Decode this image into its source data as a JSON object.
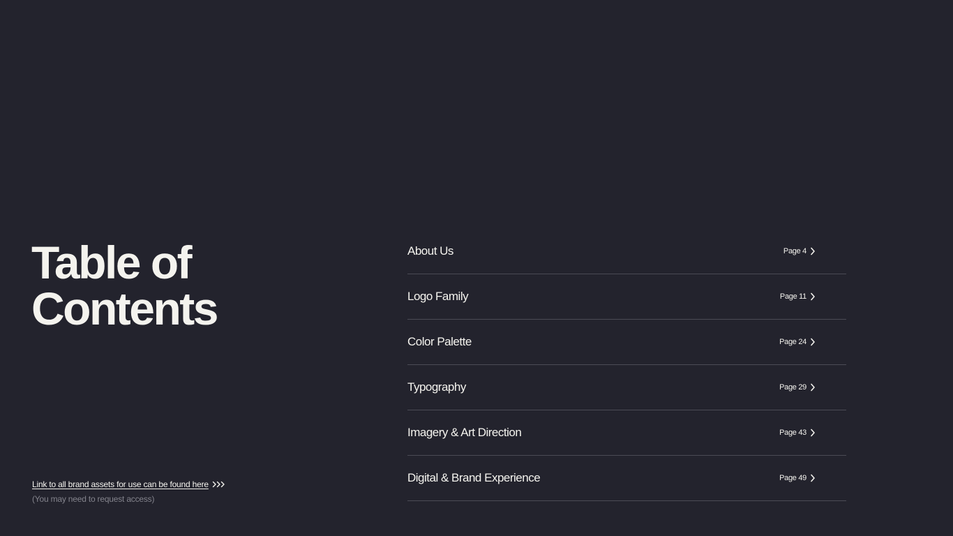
{
  "heading": {
    "line1": "Table of",
    "line2": "Contents"
  },
  "assets": {
    "link_label": "Link to all brand assets for use can be found here",
    "note": "(You may need to request access)"
  },
  "toc": {
    "items": [
      {
        "label": "About Us",
        "page": "Page 4"
      },
      {
        "label": "Logo Family",
        "page": "Page 11"
      },
      {
        "label": "Color Palette",
        "page": "Page 24"
      },
      {
        "label": "Typography",
        "page": "Page 29"
      },
      {
        "label": "Imagery & Art Direction",
        "page": "Page 43"
      },
      {
        "label": "Digital & Brand Experience",
        "page": "Page 49"
      }
    ]
  },
  "icons": {
    "row_arrow": "chevron-right-icon",
    "link_arrow": "triple-chevron-right-icon"
  },
  "colors": {
    "background": "#23232d",
    "text": "#f4f3ee",
    "muted": "#83838c",
    "divider": "#4b4b55"
  }
}
